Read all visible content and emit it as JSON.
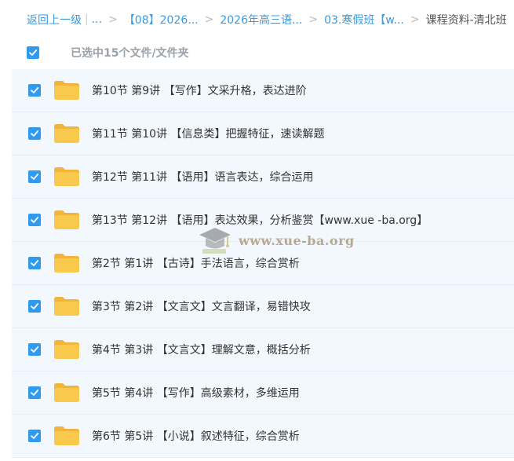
{
  "breadcrumb": {
    "back": "返回上一级",
    "divider": "|",
    "ellipsis": "...",
    "sep": ">",
    "items": [
      "【08】2026...",
      "2026年高三语...",
      "03.寒假班【w..."
    ],
    "current": "课程资料-清北班"
  },
  "selection": {
    "label": "已选中15个文件/文件夹",
    "checked": true
  },
  "files": [
    {
      "name": "第10节 第9讲 【写作】文采升格，表达进阶",
      "checked": true
    },
    {
      "name": "第11节 第10讲 【信息类】把握特征，速读解题",
      "checked": true
    },
    {
      "name": "第12节 第11讲 【语用】语言表达，综合运用",
      "checked": true
    },
    {
      "name": "第13节 第12讲 【语用】表达效果，分析鉴赏【www.xue -ba.org】",
      "checked": true
    },
    {
      "name": "第2节 第1讲 【古诗】手法语言，综合赏析",
      "checked": true
    },
    {
      "name": "第3节 第2讲 【文言文】文言翻译，易错快攻",
      "checked": true
    },
    {
      "name": "第4节 第3讲 【文言文】理解文意，概括分析",
      "checked": true
    },
    {
      "name": "第5节 第4讲 【写作】高级素材，多维运用",
      "checked": true
    },
    {
      "name": "第6节 第5讲 【小说】叙述特征，综合赏析",
      "checked": true
    }
  ],
  "watermark": {
    "text": "www.xue-ba.org"
  },
  "colors": {
    "accent": "#2f9bf0",
    "link": "#3b9ae0",
    "row_bg": "#f2f8fd",
    "folder": "#f9c94e"
  }
}
